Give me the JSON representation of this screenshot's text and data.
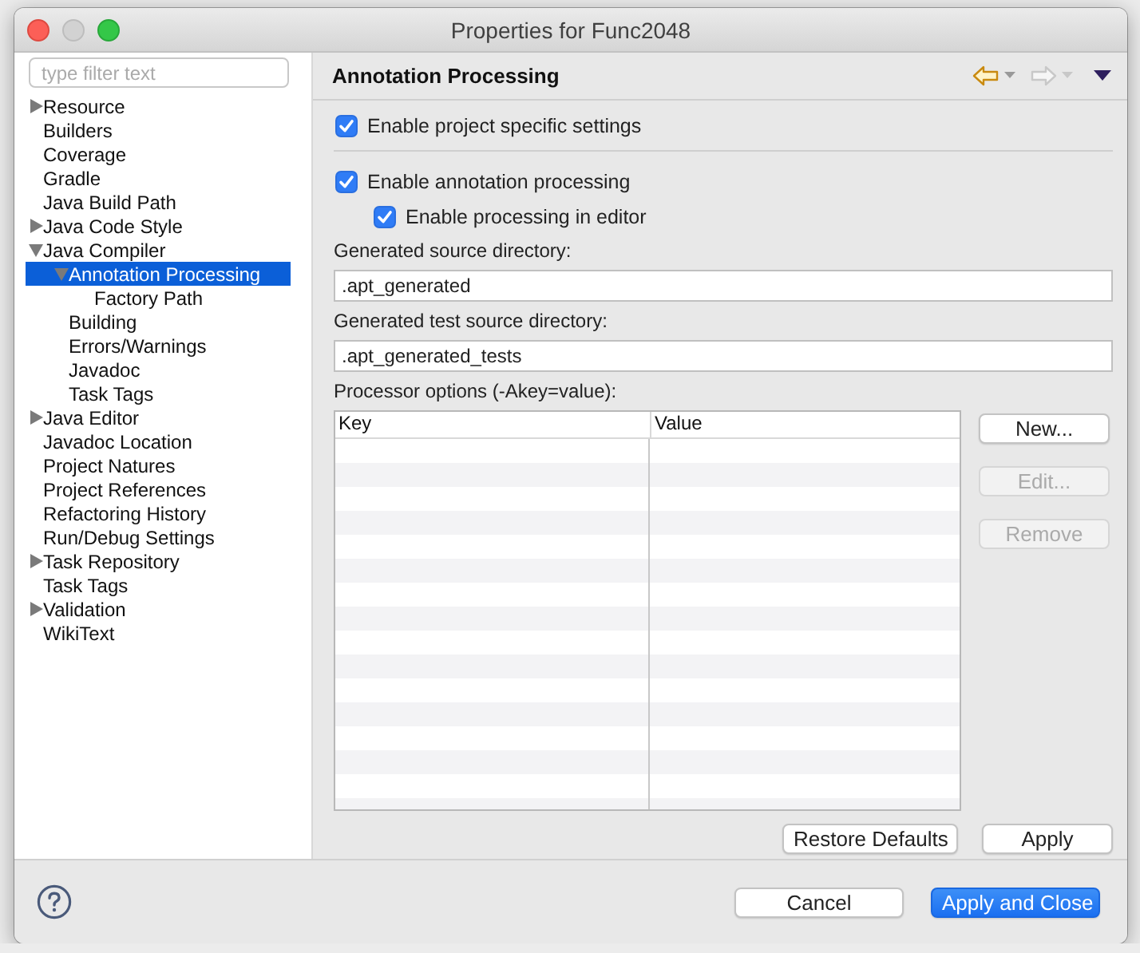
{
  "window": {
    "title": "Properties for Func2048"
  },
  "filter": {
    "placeholder": "type filter text"
  },
  "tree": [
    {
      "label": "Resource",
      "expanded": false,
      "selected": false
    },
    {
      "label": "Builders",
      "selected": false
    },
    {
      "label": "Coverage",
      "selected": false
    },
    {
      "label": "Gradle",
      "selected": false
    },
    {
      "label": "Java Build Path",
      "selected": false
    },
    {
      "label": "Java Code Style",
      "expanded": false,
      "selected": false
    },
    {
      "label": "Java Compiler",
      "expanded": true,
      "selected": false,
      "children": [
        {
          "label": "Annotation Processing",
          "expanded": true,
          "selected": true,
          "children": [
            {
              "label": "Factory Path",
              "selected": false
            }
          ]
        },
        {
          "label": "Building",
          "selected": false
        },
        {
          "label": "Errors/Warnings",
          "selected": false
        },
        {
          "label": "Javadoc",
          "selected": false
        },
        {
          "label": "Task Tags",
          "selected": false
        }
      ]
    },
    {
      "label": "Java Editor",
      "expanded": false,
      "selected": false
    },
    {
      "label": "Javadoc Location",
      "selected": false
    },
    {
      "label": "Project Natures",
      "selected": false
    },
    {
      "label": "Project References",
      "selected": false
    },
    {
      "label": "Refactoring History",
      "selected": false
    },
    {
      "label": "Run/Debug Settings",
      "selected": false
    },
    {
      "label": "Task Repository",
      "expanded": false,
      "selected": false
    },
    {
      "label": "Task Tags",
      "selected": false
    },
    {
      "label": "Validation",
      "expanded": false,
      "selected": false
    },
    {
      "label": "WikiText",
      "selected": false
    }
  ],
  "page": {
    "title": "Annotation Processing",
    "nav": [
      {
        "kind": "back",
        "disabled": false
      },
      {
        "kind": "forward",
        "disabled": true
      },
      {
        "kind": "menu",
        "disabled": false
      }
    ],
    "project_settings": {
      "label": "Enable project specific settings",
      "checked": true
    },
    "processing": {
      "label": "Enable annotation processing",
      "checked": true,
      "children": [
        {
          "label": "Enable processing in editor",
          "checked": true
        }
      ]
    },
    "fields": [
      {
        "label": "Generated source directory:",
        "value": ".apt_generated"
      },
      {
        "label": "Generated test source directory:",
        "value": ".apt_generated_tests"
      }
    ],
    "options_label": "Processor options (-Akey=value):",
    "table": {
      "columns": [
        "Key",
        "Value"
      ]
    },
    "table_buttons": [
      {
        "label": "New...",
        "disabled": false
      },
      {
        "label": "Edit...",
        "disabled": true
      },
      {
        "label": "Remove",
        "disabled": true
      }
    ],
    "page_buttons": [
      {
        "label": "Restore Defaults",
        "disabled": false
      },
      {
        "label": "Apply",
        "disabled": false
      }
    ]
  },
  "footer": {
    "buttons": [
      {
        "label": "Cancel",
        "default": false
      },
      {
        "label": "Apply and Close",
        "default": true
      }
    ]
  }
}
